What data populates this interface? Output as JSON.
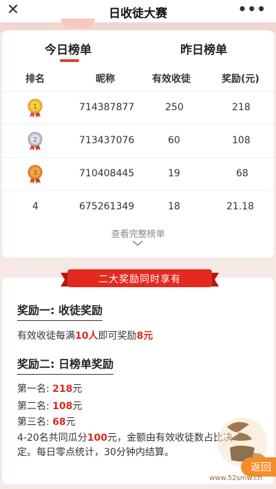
{
  "nav": {
    "close_icon": "close-icon",
    "title": "日收徒大赛",
    "more_icon": "more-dots-icon",
    "more_glyph": "•••"
  },
  "tabs": [
    {
      "label": "今日榜单",
      "active": true
    },
    {
      "label": "昨日榜单",
      "active": false
    }
  ],
  "table": {
    "columns": [
      "排名",
      "昵称",
      "有效收徒",
      "奖励(元)"
    ],
    "rows": [
      {
        "rank": "1",
        "medal": "gold",
        "nickname": "714387877",
        "count": "250",
        "reward": "218"
      },
      {
        "rank": "2",
        "medal": "silver",
        "nickname": "713437076",
        "count": "60",
        "reward": "108"
      },
      {
        "rank": "3",
        "medal": "bronze",
        "nickname": "710408445",
        "count": "19",
        "reward": "68"
      },
      {
        "rank": "4",
        "medal": "",
        "nickname": "675261349",
        "count": "18",
        "reward": "21.18"
      }
    ],
    "view_all": "查看完整榜单"
  },
  "rewards": {
    "banner": "二大奖励同时享有",
    "reward1": {
      "title": "奖励一: 收徒奖励",
      "text_a": "有效收徒每满",
      "highlight_a": "10人",
      "text_b": "即可奖励",
      "highlight_b": "8元"
    },
    "reward2": {
      "title": "奖励二: 日榜单奖励",
      "first_label": "第一名: ",
      "first_value": "218",
      "second_label": "第二名: ",
      "second_value": "108",
      "third_label": "第三名: ",
      "third_value": "68",
      "unit": "元",
      "pool_text_a": "4-20名共同瓜分",
      "pool_value": "100",
      "pool_text_b": "元，金额由有效收徒数占比决",
      "pool_text_c": "定。每日零点统计，30分钟内结算。"
    }
  },
  "overlay": {
    "back_label": "返回",
    "watermark_url": "www.52smw.cn"
  },
  "colors": {
    "accent_red": "#e63a2e",
    "highlight_red": "#d9281c",
    "back_orange": "#f58d29",
    "page_bg": "#f6e8e4"
  }
}
